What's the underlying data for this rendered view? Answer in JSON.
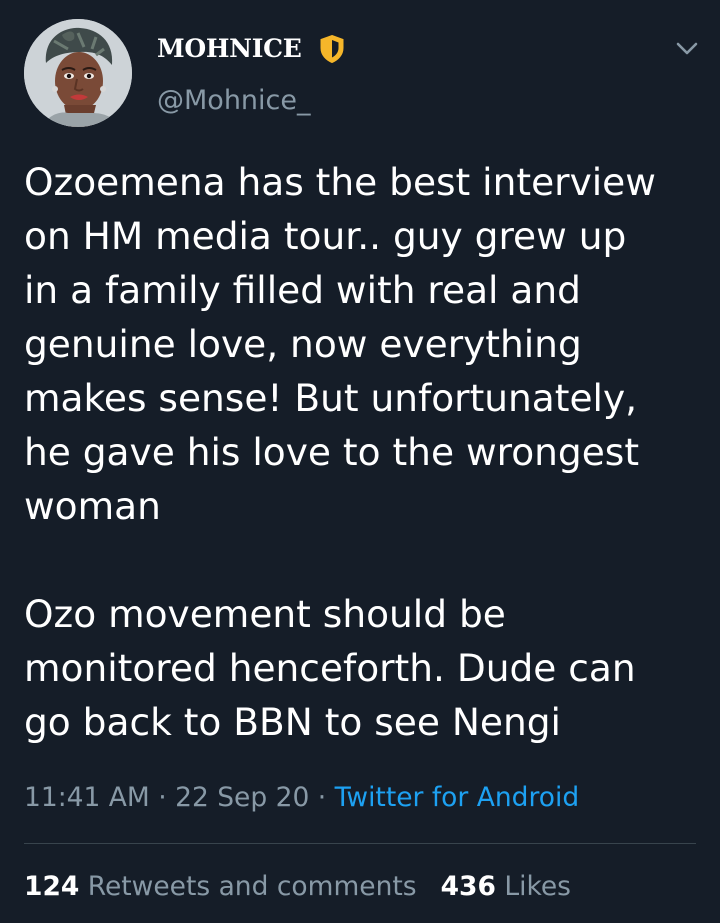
{
  "author": {
    "display_name": "MOHNICE",
    "handle": "@Mohnice_",
    "badge_icon": "shield-icon",
    "badge_color": "#f5b62a",
    "avatar": "profile-photo"
  },
  "menu_icon": "chevron-down-icon",
  "tweet": {
    "text": "Ozoemena has the best interview\non HM media tour.. guy grew up\nin a family filled with real and\ngenuine love, now everything\nmakes sense! But unfortunately,\nhe gave his love to the wrongest\nwoman\n\nOzo movement should be\nmonitored henceforth. Dude can\ngo back to BBN to see Nengi",
    "time": "11:41 AM",
    "date": "22 Sep 20",
    "separator": " · ",
    "source": "Twitter for Android"
  },
  "stats": {
    "retweets_count": "124",
    "retweets_label": " Retweets and comments",
    "likes_count": "436",
    "likes_label": " Likes"
  },
  "colors": {
    "background": "#151d28",
    "text": "#ffffff",
    "secondary": "#8899a6",
    "link": "#1da1f2",
    "divider": "#38444d"
  }
}
